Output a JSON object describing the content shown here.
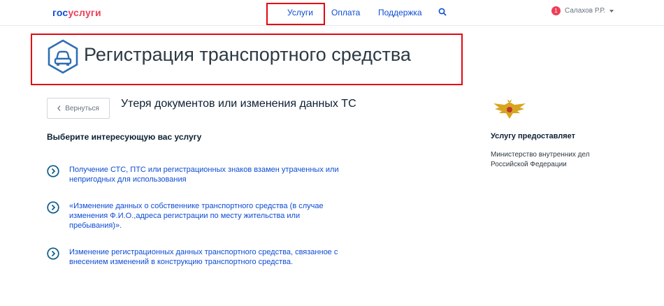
{
  "header": {
    "logo_part1": "гос",
    "logo_part2": "услуги",
    "nav": [
      "Услуги",
      "Оплата",
      "Поддержка"
    ],
    "user_badge": "1",
    "user_name": "Салахов Р.Р."
  },
  "page": {
    "title": "Регистрация транспортного средства",
    "back_label": "Вернуться",
    "subtitle": "Утеря документов или изменения данных ТС",
    "choose_label": "Выберите интересующую вас услугу"
  },
  "services": [
    "Получение СТС, ПТС или регистрационных знаков взамен утраченных или непригодных для использования",
    "«Изменение данных о собственнике транспортного средства (в случае изменения Ф.И.О.,адреса регистрации по месту жительства или пребывания)».",
    "Изменение регистрационных данных транспортного средства, связанное с внесением изменений в конструкцию транспортного средства."
  ],
  "provider": {
    "heading": "Услугу предоставляет",
    "name": "Министерство внутренних дел Российской Федерации"
  },
  "colors": {
    "link": "#0d4cd3",
    "highlight": "#e30611",
    "accent": "#ee3f58"
  }
}
